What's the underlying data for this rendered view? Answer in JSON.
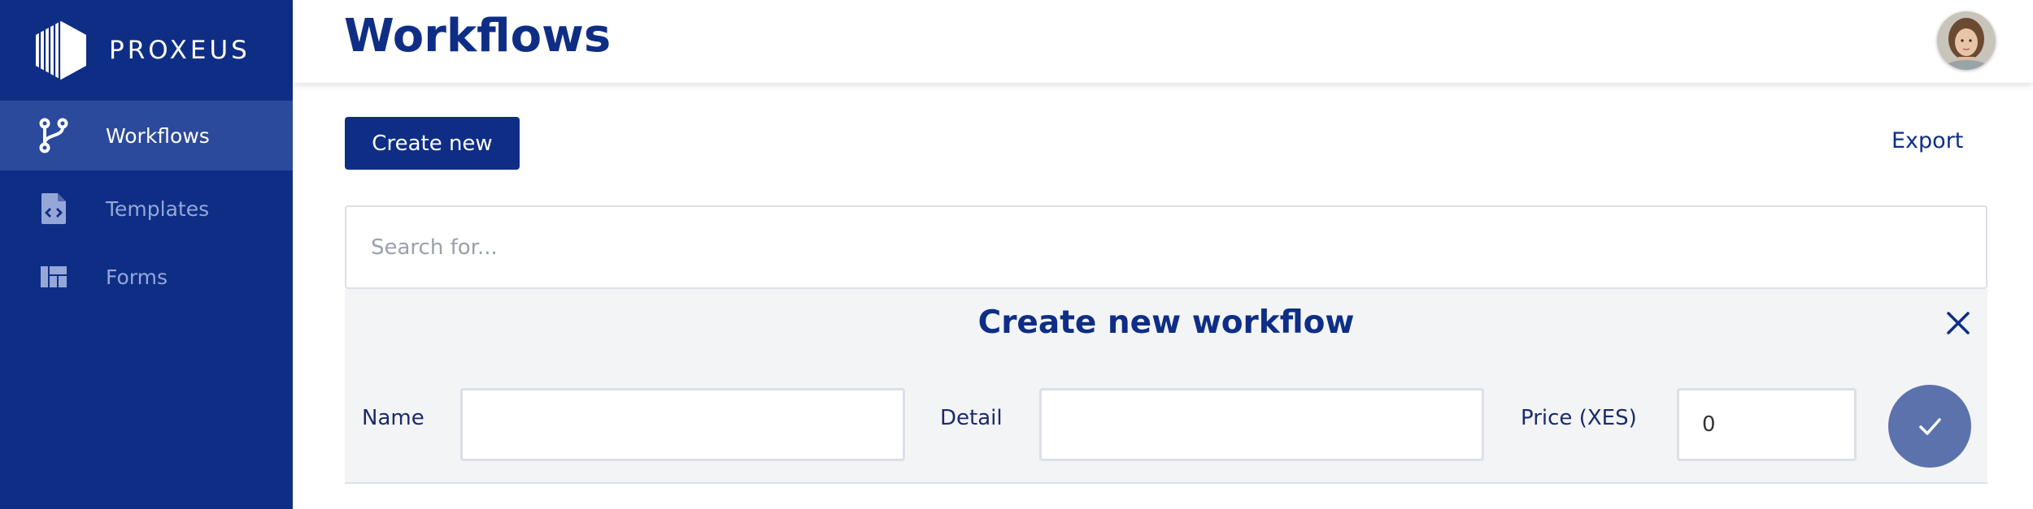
{
  "app": {
    "brand_name": "PROXEUS",
    "colors": {
      "primary": "#0e2e86",
      "sidebar_active": "#2c4a9c",
      "panel_bg": "#f3f4f6",
      "confirm": "#5b72ad"
    }
  },
  "sidebar": {
    "items": [
      {
        "label": "Workflows",
        "icon": "workflow-branch-icon",
        "active": true
      },
      {
        "label": "Templates",
        "icon": "code-file-icon",
        "active": false
      },
      {
        "label": "Forms",
        "icon": "form-layout-icon",
        "active": false
      }
    ]
  },
  "header": {
    "title": "Workflows",
    "avatar": "user-avatar"
  },
  "toolbar": {
    "create_label": "Create new",
    "export_label": "Export"
  },
  "search": {
    "placeholder": "Search for...",
    "value": ""
  },
  "create_panel": {
    "title": "Create new workflow",
    "close_icon": "close-icon",
    "fields": {
      "name": {
        "label": "Name",
        "value": ""
      },
      "detail": {
        "label": "Detail",
        "value": ""
      },
      "price": {
        "label": "Price (XES)",
        "value": "0"
      }
    },
    "confirm_icon": "checkmark-icon"
  }
}
